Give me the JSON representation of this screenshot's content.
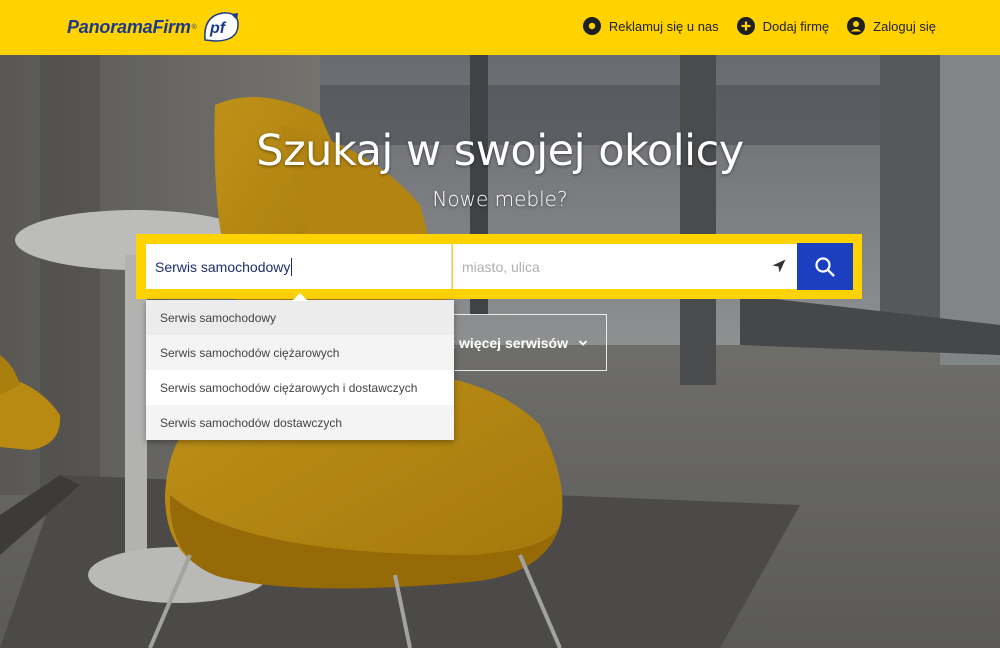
{
  "header": {
    "logo_text": "PanoramaFirm",
    "logo_reg": "®",
    "logo_badge": "pf",
    "nav": [
      {
        "label": "Reklamuj się u nas",
        "icon": "target-icon"
      },
      {
        "label": "Dodaj firmę",
        "icon": "plus-icon"
      },
      {
        "label": "Zaloguj się",
        "icon": "user-icon"
      }
    ]
  },
  "hero": {
    "headline": "Szukaj w swojej okolicy",
    "subline": "Nowe meble?"
  },
  "search": {
    "what_value": "Serwis samochodowy",
    "where_placeholder": "miasto, ulica",
    "more_label": "z więcej serwisów"
  },
  "suggestions": [
    "Serwis samochodowy",
    "Serwis samochodów ciężarowych",
    "Serwis samochodów ciężarowych i dostawczych",
    "Serwis samochodów dostawczych"
  ],
  "colors": {
    "brand_yellow": "#ffd200",
    "brand_blue": "#1b3fbf",
    "logo_blue": "#1d3a8a"
  }
}
